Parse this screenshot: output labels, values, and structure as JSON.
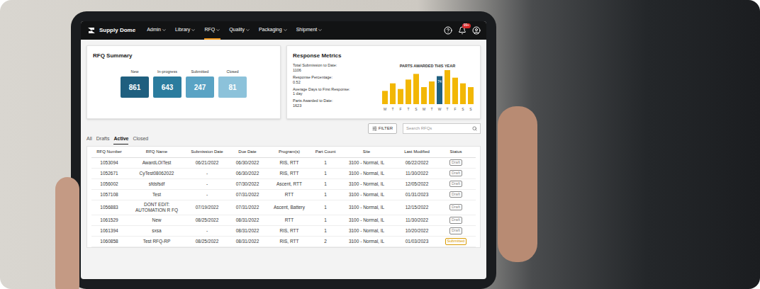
{
  "brand": {
    "name": "Supply Dome"
  },
  "nav": [
    {
      "label": "Admin",
      "selected": false
    },
    {
      "label": "Library",
      "selected": false
    },
    {
      "label": "RFQ",
      "selected": true
    },
    {
      "label": "Quality",
      "selected": false
    },
    {
      "label": "Packaging",
      "selected": false
    },
    {
      "label": "Shipment",
      "selected": false
    }
  ],
  "notifications": {
    "badge": "99+"
  },
  "rfq_summary": {
    "title": "RFQ Summary",
    "tiles": [
      {
        "label": "New",
        "count": "861",
        "color": "#1f5f7f"
      },
      {
        "label": "In-progress",
        "count": "643",
        "color": "#2b7c9e"
      },
      {
        "label": "Submitted",
        "count": "247",
        "color": "#5aa3c4"
      },
      {
        "label": "Closed",
        "count": "81",
        "color": "#8cc2da"
      }
    ]
  },
  "response_metrics": {
    "title": "Response Metrics",
    "metrics": [
      {
        "label": "Total Submission to Date:",
        "value": "1106"
      },
      {
        "label": "Response Percentage:",
        "value": "0.52"
      },
      {
        "label": "Average Days to First Response:",
        "value": "1 day"
      },
      {
        "label": "Parts Awarded to Date:",
        "value": "1623"
      }
    ],
    "chart": {
      "title": "PARTS AWARDED THIS YEAR",
      "values": [
        35,
        55,
        40,
        65,
        80,
        45,
        60,
        74,
        90,
        70,
        55,
        45
      ],
      "labels": [
        "M",
        "T",
        "F",
        "T",
        "S",
        "M",
        "T",
        "W",
        "T",
        "F",
        "S",
        "S"
      ],
      "highlighted": 7,
      "highlight_label": "74"
    }
  },
  "filter": {
    "label": "FILTER"
  },
  "search": {
    "placeholder": "Search RFQs"
  },
  "tabs": [
    {
      "label": "All",
      "selected": false
    },
    {
      "label": "Drafts",
      "selected": false
    },
    {
      "label": "Active",
      "selected": true
    },
    {
      "label": "Closed",
      "selected": false
    }
  ],
  "table": {
    "columns": [
      "RFQ Number",
      "RFQ Name",
      "Submission Date",
      "Due Date",
      "Program(s)",
      "Part Count",
      "Site",
      "Last Modified",
      "Status"
    ],
    "rows": [
      {
        "cells": [
          "1053094",
          "AwardLOITest",
          "06/21/2022",
          "06/30/2022",
          "RIS, RTT",
          "1",
          "3100 - Normal, IL",
          "06/22/2022"
        ],
        "status": "Draft",
        "status_color": "#8a8a8a"
      },
      {
        "cells": [
          "1052671",
          "CyTest08062022",
          "-",
          "06/30/2022",
          "RIS, RTT",
          "1",
          "3100 - Normal, IL",
          "11/30/2022"
        ],
        "status": "Draft",
        "status_color": "#8a8a8a"
      },
      {
        "cells": [
          "1056002",
          "sfdsfsdf",
          "-",
          "07/30/2022",
          "Ascent, RTT",
          "1",
          "3100 - Normal, IL",
          "12/05/2022"
        ],
        "status": "Draft",
        "status_color": "#8a8a8a"
      },
      {
        "cells": [
          "1057108",
          "Test",
          "-",
          "07/31/2022",
          "RTT",
          "1",
          "3100 - Normal, IL",
          "01/31/2023"
        ],
        "status": "Draft",
        "status_color": "#8a8a8a"
      },
      {
        "cells": [
          "1056883",
          "DONT EDIT: AUTOMATION R FQ",
          "07/19/2022",
          "07/31/2022",
          "Ascent, Battery",
          "1",
          "3100 - Normal, IL",
          "12/15/2022"
        ],
        "status": "Draft",
        "status_color": "#8a8a8a"
      },
      {
        "cells": [
          "1061529",
          "New",
          "08/25/2022",
          "08/31/2022",
          "RTT",
          "1",
          "3100 - Normal, IL",
          "11/30/2022"
        ],
        "status": "Draft",
        "status_color": "#8a8a8a"
      },
      {
        "cells": [
          "1061394",
          "sxsa",
          "-",
          "08/31/2022",
          "RIS, RTT",
          "1",
          "3100 - Normal, IL",
          "10/20/2022"
        ],
        "status": "Draft",
        "status_color": "#8a8a8a"
      },
      {
        "cells": [
          "1060858",
          "Test RFQ-RP",
          "08/25/2022",
          "08/31/2022",
          "RIS, RTT",
          "2",
          "3100 - Normal, IL",
          "01/03/2023"
        ],
        "status": "Submitted",
        "status_color": "#d99a00"
      }
    ]
  }
}
